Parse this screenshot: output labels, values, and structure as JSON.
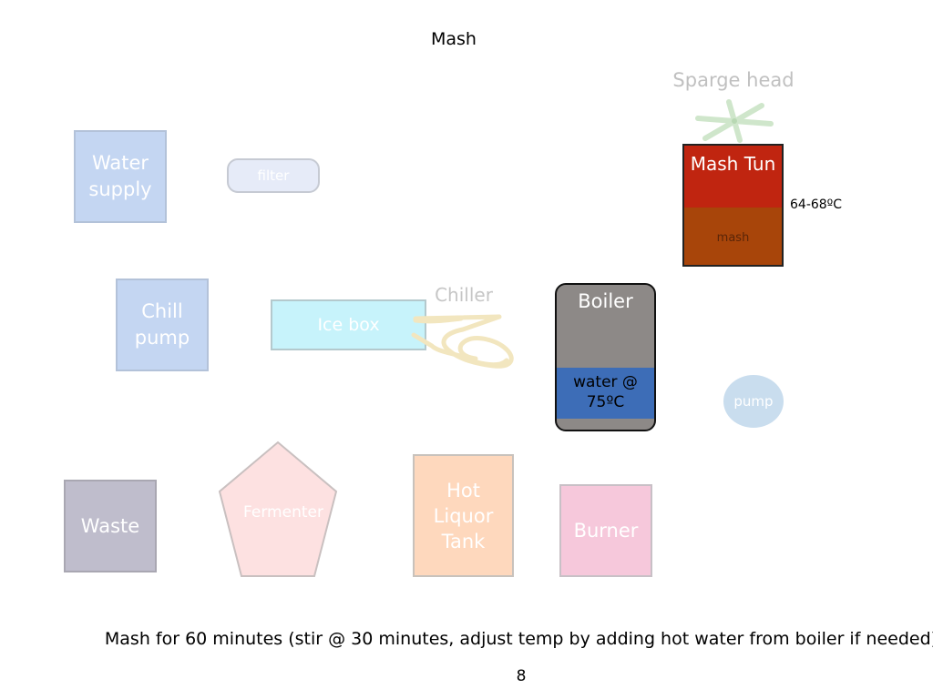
{
  "title": "Mash",
  "nodes": {
    "water_supply": "Water supply",
    "filter": "filter",
    "chill_pump": "Chill pump",
    "ice_box": "Ice box",
    "chiller": "Chiller",
    "sparge_head": "Sparge head",
    "mash_tun": "Mash Tun",
    "mash": "mash",
    "mash_temp": "64-68ºC",
    "boiler": "Boiler",
    "boiler_water": "water @ 75ºC",
    "pump": "pump",
    "waste": "Waste",
    "fermenter": "Fermenter",
    "hot_liquor_tank": "Hot Liquor Tank",
    "burner": "Burner"
  },
  "footnote": "Mash for 60 minutes (stir @ 30 minutes, adjust temp by adding hot water from boiler if needed)",
  "page_number": "8",
  "colors": {
    "blue_box": "#c4d6f2",
    "ice_box": "#c7f3fb",
    "mash_tun_top": "#c02510",
    "mash_layer": "#a8450a",
    "boiler": "#8d8987",
    "boiler_water": "#3d6db7",
    "waste": "#bfbdcc",
    "fermenter": "#fde1e1",
    "hot_liquor_tank": "#fed8bd",
    "burner": "#f6c8db",
    "pump": "#c9ddee"
  }
}
